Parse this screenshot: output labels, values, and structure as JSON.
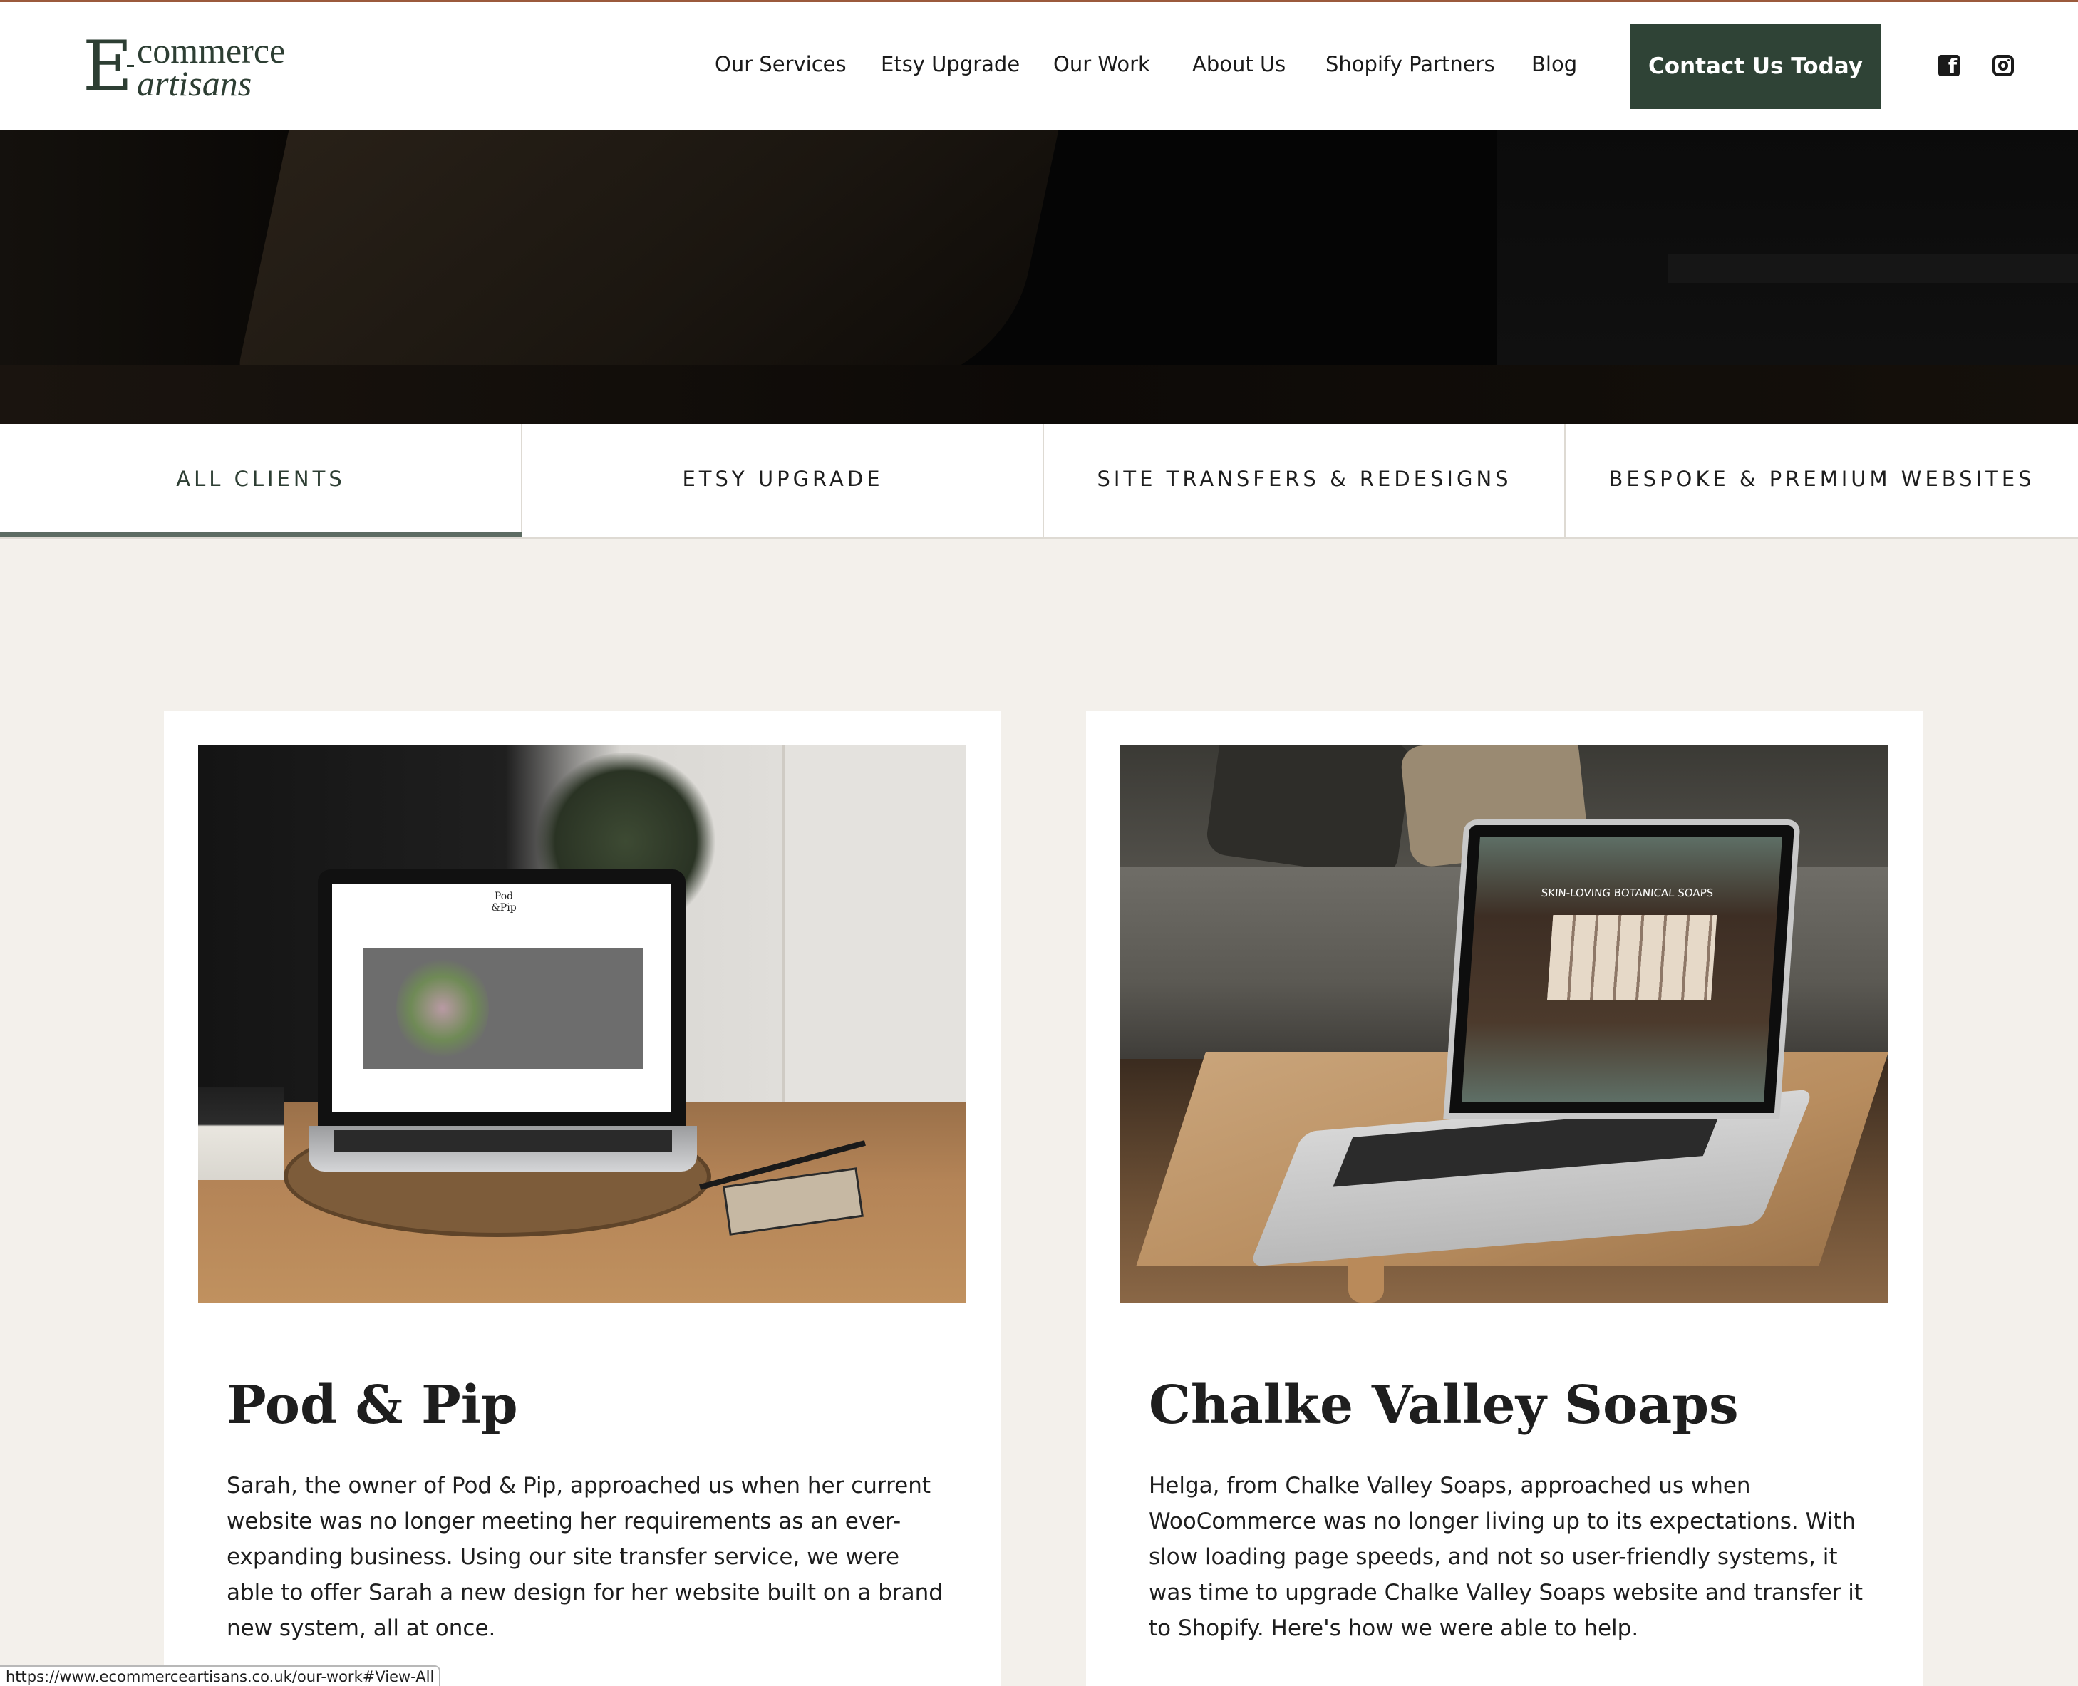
{
  "header": {
    "logo": {
      "letter": "E",
      "top": "commerce",
      "bottom": "artisans"
    },
    "nav": [
      {
        "label": "Our Services"
      },
      {
        "label": "Etsy Upgrade"
      },
      {
        "label": "Our Work"
      },
      {
        "label": "About Us"
      },
      {
        "label": "Shopify Partners"
      },
      {
        "label": "Blog"
      }
    ],
    "cta_label": "Contact Us Today",
    "social": {
      "facebook_icon": "facebook-icon",
      "instagram_icon": "instagram-icon",
      "fb_glyph": "f"
    }
  },
  "tabs": [
    {
      "label": "ALL CLIENTS",
      "active": true
    },
    {
      "label": "ETSY UPGRADE",
      "active": false
    },
    {
      "label": "SITE TRANSFERS & REDESIGNS",
      "active": false
    },
    {
      "label": "BESPOKE & PREMIUM WEBSITES",
      "active": false
    }
  ],
  "cards": [
    {
      "title": "Pod & Pip",
      "description": "Sarah, the owner of Pod & Pip, approached us when her current website was no longer meeting her requirements as an ever-expanding business. Using our site transfer service, we were able to offer Sarah a new design for her website built on a brand new system, all at once.",
      "screen_logo": "Pod &Pip"
    },
    {
      "title": "Chalke Valley Soaps",
      "description": "Helga, from Chalke Valley Soaps, approached us when WooCommerce was no longer living up to its expectations. With slow loading page speeds, and not so user-friendly systems, it was time to upgrade Chalke Valley Soaps website and transfer it to Shopify. Here's how we were able to help.",
      "screen_text": "SKIN-LOVING BOTANICAL SOAPS"
    }
  ],
  "status_url": "https://www.ecommerceartisans.co.uk/our-work#View-All",
  "colors": {
    "brand_dark_green": "#2f4336",
    "page_bg": "#f3f0eb",
    "top_accent": "#9b5a3c",
    "tab_underline": "#5c6b62"
  }
}
